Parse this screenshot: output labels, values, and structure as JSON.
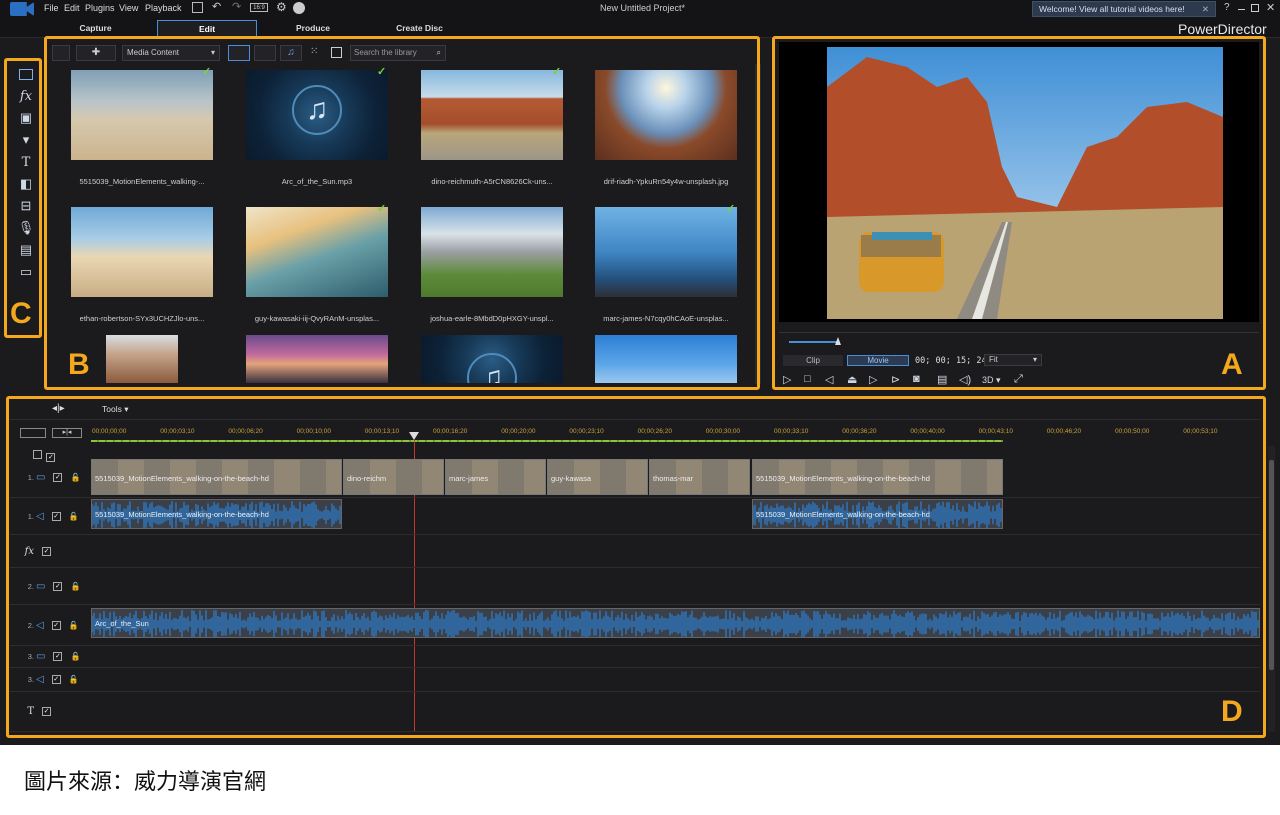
{
  "titlebar": {
    "project": "New Untitled Project*",
    "welcome": "Welcome! View all tutorial videos here!",
    "brand": "PowerDirector",
    "help": "?"
  },
  "menu": [
    "File",
    "Edit",
    "Plugins",
    "View",
    "Playback"
  ],
  "modes": [
    "Capture",
    "Edit",
    "Produce",
    "Create Disc"
  ],
  "library": {
    "dropdown": "Media Content",
    "search_placeholder": "Search the library",
    "items": [
      {
        "label": "5515039_MotionElements_walking-...",
        "checked": true,
        "style": "beach"
      },
      {
        "label": "Arc_of_the_Sun.mp3",
        "checked": true,
        "style": "music"
      },
      {
        "label": "dino-reichmuth-A5rCN8626Ck-uns...",
        "checked": true,
        "style": "canyon"
      },
      {
        "label": "drif-riadh-YpkuRn54y4w-unsplash.jpg",
        "checked": false,
        "style": "sunset"
      },
      {
        "label": "ethan-robertson-SYx3UCHZJlo-uns...",
        "checked": false,
        "style": "sand"
      },
      {
        "label": "guy-kawasaki-iij-QvyRAnM-unsplas...",
        "checked": true,
        "style": "surf"
      },
      {
        "label": "joshua-earle-8MbdD0pHXGY-unspl...",
        "checked": false,
        "style": "mountain"
      },
      {
        "label": "marc-james-N7cqy0hCAoE-unsplas...",
        "checked": true,
        "style": "ocean"
      },
      {
        "label": "",
        "checked": false,
        "style": "tower"
      },
      {
        "label": "",
        "checked": false,
        "style": "dusk"
      },
      {
        "label": "",
        "checked": false,
        "style": "music"
      },
      {
        "label": "",
        "checked": false,
        "style": "sky"
      }
    ]
  },
  "preview": {
    "clip_tab": "Clip",
    "movie_tab": "Movie",
    "timecode": "00; 00; 15; 24",
    "zoom": "Fit",
    "mode_3d": "3D"
  },
  "timeline": {
    "tools_label": "Tools",
    "ruler": [
      "00;00;00;00",
      "00;00;03;10",
      "00;00;06;20",
      "00;00;10;00",
      "00;00;13;10",
      "00;00;16;20",
      "00;00;20;00",
      "00;00;23;10",
      "00;00;26;20",
      "00;00;30;00",
      "00;00;33;10",
      "00;00;36;20",
      "00;00;40;00",
      "00;00;43;10",
      "00;00;46;20",
      "00;00;50;00",
      "00;00;53;10"
    ],
    "tracks": [
      {
        "label": "1.",
        "kind": "video"
      },
      {
        "label": "1.",
        "kind": "audio"
      },
      {
        "label": "fx",
        "kind": "fx"
      },
      {
        "label": "2.",
        "kind": "video"
      },
      {
        "label": "2.",
        "kind": "audio"
      },
      {
        "label": "3.",
        "kind": "video"
      },
      {
        "label": "3.",
        "kind": "audio"
      },
      {
        "label": "T",
        "kind": "title"
      }
    ],
    "clips": [
      {
        "label": "5515039_MotionElements_walking-on-the-beach-hd"
      },
      {
        "label": "dino-reichm"
      },
      {
        "label": "marc-james"
      },
      {
        "label": "guy-kawasa"
      },
      {
        "label": "thomas-mar"
      },
      {
        "label": "5515039_MotionElements_walking-on-the-beach-hd"
      }
    ],
    "audio_clips": [
      {
        "label": "5515039_MotionElements_walking-on-the-beach-hd"
      },
      {
        "label": "5515039_MotionElements_walking-on-the-beach-hd"
      },
      {
        "label": "Arc_of_the_Sun"
      }
    ]
  },
  "panel_letters": {
    "a": "A",
    "b": "B",
    "c": "C",
    "d": "D"
  },
  "caption": "圖片來源：威力導演官網",
  "colors": {
    "accent_frame": "#f3a81e",
    "accent_blue": "#4a8dd8",
    "bg": "#1b1b1d"
  }
}
